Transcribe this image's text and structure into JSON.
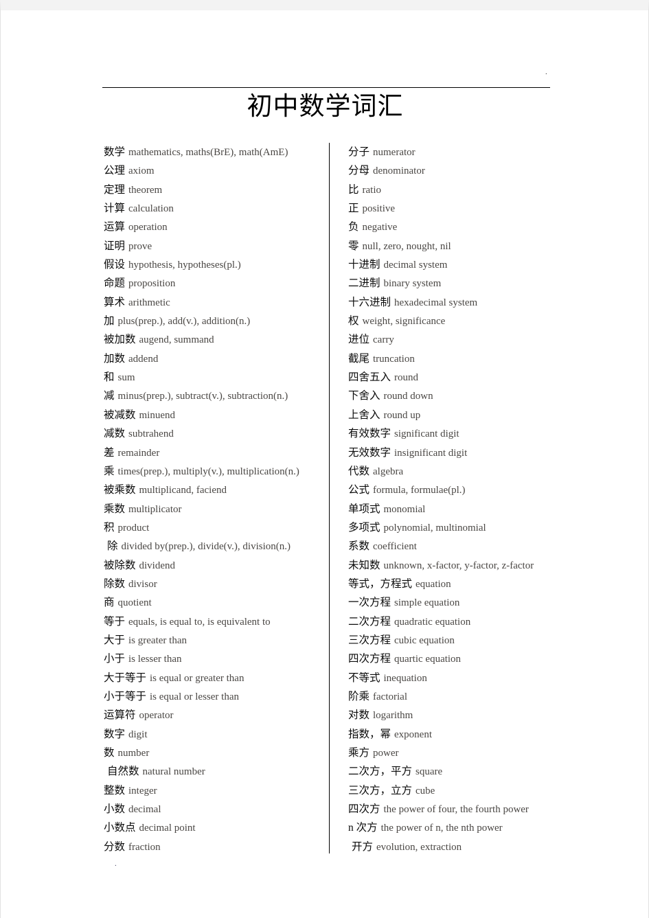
{
  "document": {
    "title": "初中数学词汇",
    "header_mark": ".",
    "footer_mark": "."
  },
  "colors": {
    "page_background": "#ffffff",
    "canvas_background": "#f3f3f3",
    "chinese_text": "#0b0b0b",
    "english_text": "#4a4744",
    "rule": "#000000"
  },
  "columns": {
    "left": [
      {
        "zh": "数学",
        "en": "mathematics, maths(BrE), math(AmE)",
        "indent": false
      },
      {
        "zh": "公理",
        "en": "axiom",
        "indent": false
      },
      {
        "zh": "定理",
        "en": "theorem",
        "indent": false
      },
      {
        "zh": "计算",
        "en": "calculation",
        "indent": false
      },
      {
        "zh": "运算",
        "en": "operation",
        "indent": false
      },
      {
        "zh": "证明",
        "en": "prove",
        "indent": false
      },
      {
        "zh": "假设",
        "en": "hypothesis, hypotheses(pl.)",
        "indent": false
      },
      {
        "zh": "命题",
        "en": "proposition",
        "indent": false
      },
      {
        "zh": "算术",
        "en": "arithmetic",
        "indent": false
      },
      {
        "zh": "加",
        "en": "plus(prep.), add(v.), addition(n.)",
        "indent": false
      },
      {
        "zh": "被加数",
        "en": "augend, summand",
        "indent": false
      },
      {
        "zh": "加数",
        "en": "addend",
        "indent": false
      },
      {
        "zh": "和",
        "en": "sum",
        "indent": false
      },
      {
        "zh": "减",
        "en": "minus(prep.), subtract(v.), subtraction(n.)",
        "indent": false
      },
      {
        "zh": "被减数",
        "en": "minuend",
        "indent": false
      },
      {
        "zh": "减数",
        "en": "subtrahend",
        "indent": false
      },
      {
        "zh": "差",
        "en": "remainder",
        "indent": false
      },
      {
        "zh": "乘",
        "en": "times(prep.), multiply(v.), multiplication(n.)",
        "indent": false
      },
      {
        "zh": "被乘数",
        "en": "multiplicand, faciend",
        "indent": false
      },
      {
        "zh": "乘数",
        "en": "multiplicator",
        "indent": false
      },
      {
        "zh": "积",
        "en": "product",
        "indent": false
      },
      {
        "zh": "除",
        "en": "divided by(prep.), divide(v.), division(n.)",
        "indent": true
      },
      {
        "zh": "被除数",
        "en": "dividend",
        "indent": false
      },
      {
        "zh": "除数",
        "en": "divisor",
        "indent": false
      },
      {
        "zh": "商",
        "en": "quotient",
        "indent": false
      },
      {
        "zh": "等于",
        "en": "equals, is equal to, is equivalent to",
        "indent": false
      },
      {
        "zh": "大于",
        "en": "is greater than",
        "indent": false
      },
      {
        "zh": "小于",
        "en": "is lesser than",
        "indent": false
      },
      {
        "zh": "大于等于",
        "en": "is equal or greater than",
        "indent": false
      },
      {
        "zh": "小于等于",
        "en": "is equal or lesser than",
        "indent": false
      },
      {
        "zh": "运算符",
        "en": "operator",
        "indent": false
      },
      {
        "zh": "数字",
        "en": "digit",
        "indent": false
      },
      {
        "zh": "数",
        "en": "number",
        "indent": false
      },
      {
        "zh": "自然数",
        "en": "natural number",
        "indent": true
      },
      {
        "zh": "整数",
        "en": "integer",
        "indent": false
      },
      {
        "zh": "小数",
        "en": "decimal",
        "indent": false
      },
      {
        "zh": "小数点",
        "en": "decimal point",
        "indent": false
      },
      {
        "zh": "分数",
        "en": "fraction",
        "indent": false
      }
    ],
    "right": [
      {
        "zh": "分子",
        "en": "numerator",
        "indent": false
      },
      {
        "zh": "分母",
        "en": "denominator",
        "indent": false
      },
      {
        "zh": "比",
        "en": "ratio",
        "indent": false
      },
      {
        "zh": "正",
        "en": "positive",
        "indent": false
      },
      {
        "zh": "负",
        "en": "negative",
        "indent": false
      },
      {
        "zh": "零",
        "en": "null, zero, nought, nil",
        "indent": false
      },
      {
        "zh": "十进制",
        "en": "decimal system",
        "indent": false
      },
      {
        "zh": "二进制",
        "en": "binary system",
        "indent": false
      },
      {
        "zh": "十六进制",
        "en": "hexadecimal system",
        "indent": false
      },
      {
        "zh": "权",
        "en": "weight, significance",
        "indent": false
      },
      {
        "zh": "进位",
        "en": "carry",
        "indent": false
      },
      {
        "zh": "截尾",
        "en": "truncation",
        "indent": false
      },
      {
        "zh": "四舍五入",
        "en": "round",
        "indent": false
      },
      {
        "zh": "下舍入",
        "en": "round down",
        "indent": false
      },
      {
        "zh": "上舍入",
        "en": "round up",
        "indent": false
      },
      {
        "zh": "有效数字",
        "en": "significant digit",
        "indent": false
      },
      {
        "zh": "无效数字",
        "en": "insignificant digit",
        "indent": false
      },
      {
        "zh": "代数",
        "en": "algebra",
        "indent": false
      },
      {
        "zh": "公式",
        "en": "formula, formulae(pl.)",
        "indent": false
      },
      {
        "zh": "单项式",
        "en": "monomial",
        "indent": false
      },
      {
        "zh": "多项式",
        "en": "polynomial, multinomial",
        "indent": false
      },
      {
        "zh": "系数",
        "en": "coefficient",
        "indent": false
      },
      {
        "zh": "未知数",
        "en": "unknown, x-factor, y-factor, z-factor",
        "indent": false
      },
      {
        "zh": "等式，方程式",
        "en": "equation",
        "indent": false
      },
      {
        "zh": "一次方程",
        "en": "simple equation",
        "indent": false
      },
      {
        "zh": "二次方程",
        "en": "quadratic equation",
        "indent": false
      },
      {
        "zh": "三次方程",
        "en": "cubic equation",
        "indent": false
      },
      {
        "zh": "四次方程",
        "en": "quartic equation",
        "indent": false
      },
      {
        "zh": "不等式",
        "en": "inequation",
        "indent": false
      },
      {
        "zh": "阶乘",
        "en": "factorial",
        "indent": false
      },
      {
        "zh": "对数",
        "en": "logarithm",
        "indent": false
      },
      {
        "zh": "指数，幂",
        "en": "exponent",
        "indent": false
      },
      {
        "zh": "乘方",
        "en": "power",
        "indent": false
      },
      {
        "zh": "二次方，平方",
        "en": "square",
        "indent": false
      },
      {
        "zh": "三次方，立方",
        "en": "cube",
        "indent": false
      },
      {
        "zh": "四次方",
        "en": "the power of four, the fourth power",
        "indent": false
      },
      {
        "zh": "n 次方",
        "en": "the power of n, the nth power",
        "indent": false
      },
      {
        "zh": "开方",
        "en": "evolution, extraction",
        "indent": true
      }
    ]
  }
}
